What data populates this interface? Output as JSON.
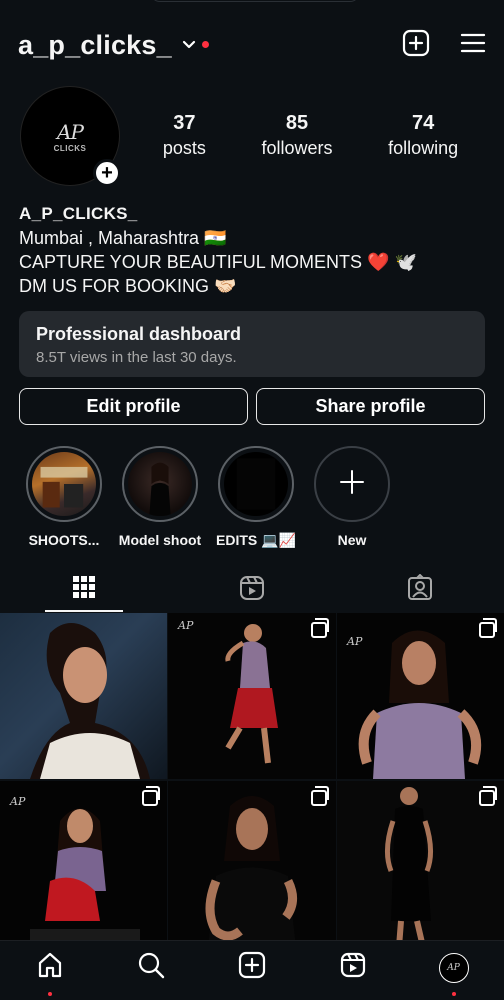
{
  "header": {
    "username": "a_p_clicks_",
    "colors": {
      "notification_dot": "#ff3040",
      "background": "#0c1014"
    },
    "icons": [
      "chevron-down-icon",
      "create-post-icon",
      "menu-icon"
    ]
  },
  "profile": {
    "avatar_logo": "AP",
    "avatar_logo_sub": "CLICKS",
    "stats": [
      {
        "num": "37",
        "label": "posts"
      },
      {
        "num": "85",
        "label": "followers"
      },
      {
        "num": "74",
        "label": "following"
      }
    ]
  },
  "bio": {
    "name": "A_P_CLICKS_",
    "line1": "Mumbai , Maharashtra 🇮🇳",
    "line2": "CAPTURE YOUR BEAUTIFUL MOMENTS ❤️ 🕊️",
    "line3": "DM US FOR BOOKING 🤝🏻"
  },
  "dashboard": {
    "title": "Professional dashboard",
    "subtitle": "8.5T views in the last 30 days."
  },
  "buttons": {
    "edit": "Edit profile",
    "share": "Share profile"
  },
  "highlights": [
    {
      "label": "SHOOTS..."
    },
    {
      "label": "Model shoot"
    },
    {
      "label": "EDITS 💻📈"
    },
    {
      "label": "New"
    }
  ],
  "tabs": [
    "grid-icon",
    "reels-icon",
    "tagged-icon"
  ],
  "grid": {
    "watermark": "AP"
  },
  "nav": [
    "home-icon",
    "search-icon",
    "create-icon",
    "reels-icon",
    "profile-avatar"
  ]
}
